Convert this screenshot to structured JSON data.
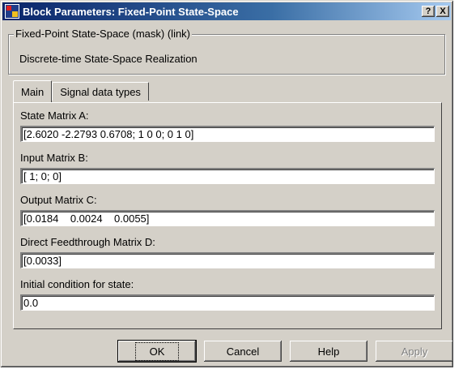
{
  "window": {
    "title": "Block Parameters: Fixed-Point State-Space",
    "help_glyph": "?",
    "close_glyph": "X"
  },
  "mask": {
    "group_title": "Fixed-Point State-Space (mask) (link)",
    "description": "Discrete-time State-Space Realization"
  },
  "tabs": [
    {
      "label": "Main",
      "active": true
    },
    {
      "label": "Signal data types",
      "active": false
    }
  ],
  "params": {
    "a_label": "State Matrix A:",
    "a_value": "[2.6020 -2.2793 0.6708; 1 0 0; 0 1 0]",
    "b_label": "Input Matrix B:",
    "b_value": "[ 1; 0; 0]",
    "c_label": "Output Matrix C:",
    "c_value": "[0.0184    0.0024    0.0055]",
    "d_label": "Direct Feedthrough Matrix D:",
    "d_value": "[0.0033]",
    "ic_label": "Initial condition for state:",
    "ic_value": "0.0"
  },
  "buttons": {
    "ok": "OK",
    "cancel": "Cancel",
    "help": "Help",
    "apply": "Apply"
  },
  "colors": {
    "titlebar_start": "#0a246a",
    "titlebar_end": "#a6caf0",
    "face": "#d4d0c8"
  }
}
